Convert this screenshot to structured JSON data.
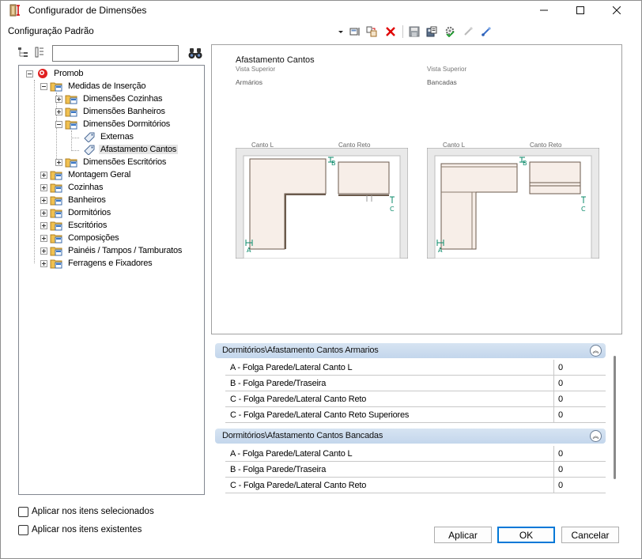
{
  "window": {
    "title": "Configurador de Dimensões"
  },
  "header": {
    "config_label": "Configuração Padrão"
  },
  "toolbar": {
    "icons": [
      "dropdown-arrow-icon",
      "cabinet-view-icon",
      "copy-settings-icon",
      "delete-icon",
      "save-icon",
      "save-as-icon",
      "apply-gear-icon",
      "link-icon",
      "link-blue-icon"
    ],
    "accent": "#cc0000"
  },
  "search": {
    "value": "",
    "placeholder": ""
  },
  "tree": {
    "nodes": [
      {
        "label": "Promob"
      },
      {
        "label": "Medidas de Inserção"
      },
      {
        "label": "Dimensões Cozinhas"
      },
      {
        "label": "Dimensões Banheiros"
      },
      {
        "label": "Dimensões Dormitórios"
      },
      {
        "label": "Externas"
      },
      {
        "label": "Afastamento Cantos"
      },
      {
        "label": "Dimensões Escritórios"
      },
      {
        "label": "Montagem Geral"
      },
      {
        "label": "Cozinhas"
      },
      {
        "label": "Banheiros"
      },
      {
        "label": "Dormitórios"
      },
      {
        "label": "Escritórios"
      },
      {
        "label": "Composições"
      },
      {
        "label": "Painéis / Tampos / Tamburatos"
      },
      {
        "label": "Ferragens e Fixadores"
      }
    ]
  },
  "preview": {
    "title": "Afastamento Cantos",
    "left": {
      "view": "Vista Superior",
      "caption": "Armários",
      "label_l": "Canto L",
      "label_reto": "Canto Reto"
    },
    "right": {
      "view": "Vista Superior",
      "caption": "Bancadas",
      "label_l": "Canto L",
      "label_reto": "Canto Reto"
    },
    "markers": {
      "a": "A",
      "b": "B",
      "c": "C"
    },
    "accent": "#0a8a6a"
  },
  "groups": [
    {
      "title": "Dormitórios\\Afastamento Cantos Armarios",
      "rows": [
        {
          "label": "A - Folga Parede/Lateral Canto L",
          "value": "0"
        },
        {
          "label": "B - Folga Parede/Traseira",
          "value": "0"
        },
        {
          "label": "C - Folga Parede/Lateral Canto Reto",
          "value": "0"
        },
        {
          "label": "C - Folga Parede/Lateral Canto Reto Superiores",
          "value": "0"
        }
      ]
    },
    {
      "title": "Dormitórios\\Afastamento Cantos Bancadas",
      "rows": [
        {
          "label": "A - Folga Parede/Lateral Canto L",
          "value": "0"
        },
        {
          "label": "B - Folga Parede/Traseira",
          "value": "0"
        },
        {
          "label": "C - Folga Parede/Lateral Canto Reto",
          "value": "0"
        }
      ]
    }
  ],
  "checkboxes": {
    "selected": {
      "label": "Aplicar nos itens selecionados",
      "checked": false
    },
    "existing": {
      "label": "Aplicar nos itens existentes",
      "checked": false
    }
  },
  "buttons": {
    "apply": "Aplicar",
    "ok": "OK",
    "cancel": "Cancelar"
  }
}
